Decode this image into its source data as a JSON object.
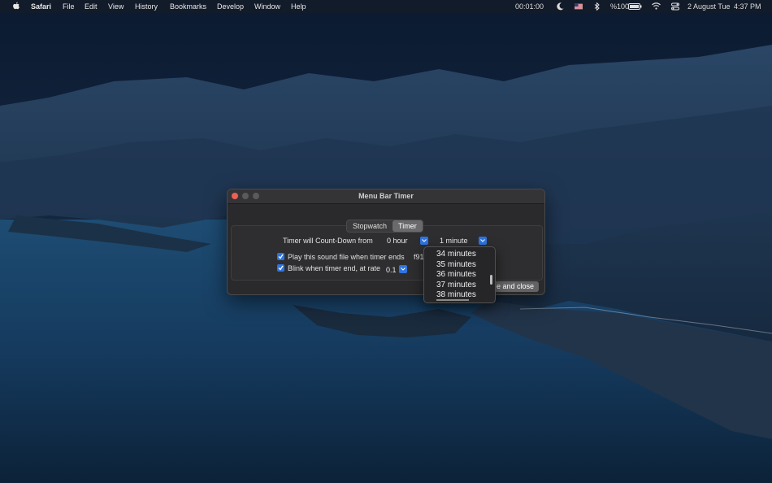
{
  "menubar": {
    "app_name": "Safari",
    "items": [
      "File",
      "Edit",
      "View",
      "History",
      "Bookmarks",
      "Develop",
      "Window",
      "Help"
    ],
    "timer_readout": "00:01:00",
    "battery": "%100",
    "date": "2 August Tue",
    "time": "4:37 PM",
    "icons": [
      "apple-icon",
      "moon-icon",
      "flag-icon",
      "bluetooth-icon",
      "battery-icon",
      "wifi-icon",
      "control-center-icon"
    ]
  },
  "window": {
    "title": "Menu Bar Timer",
    "tabs": [
      "Stopwatch",
      "Timer"
    ],
    "active_tab": "Timer",
    "countdown_label": "Timer will Count-Down from",
    "hour_value": "0 hour",
    "minute_value": "1 minute",
    "sound_label": "Play this sound file when timer ends",
    "sound_file": "f91",
    "sound_checked": true,
    "blink_label": "Blink when timer end, at rate",
    "blink_rate": "0.1",
    "blink_checked": true,
    "save_button": "e and close"
  },
  "dropdown": {
    "options": [
      "34 minutes",
      "35 minutes",
      "36 minutes",
      "37 minutes",
      "38 minutes"
    ]
  },
  "colors": {
    "accent": "#2f74e0",
    "close_light": "#ed5f56"
  }
}
